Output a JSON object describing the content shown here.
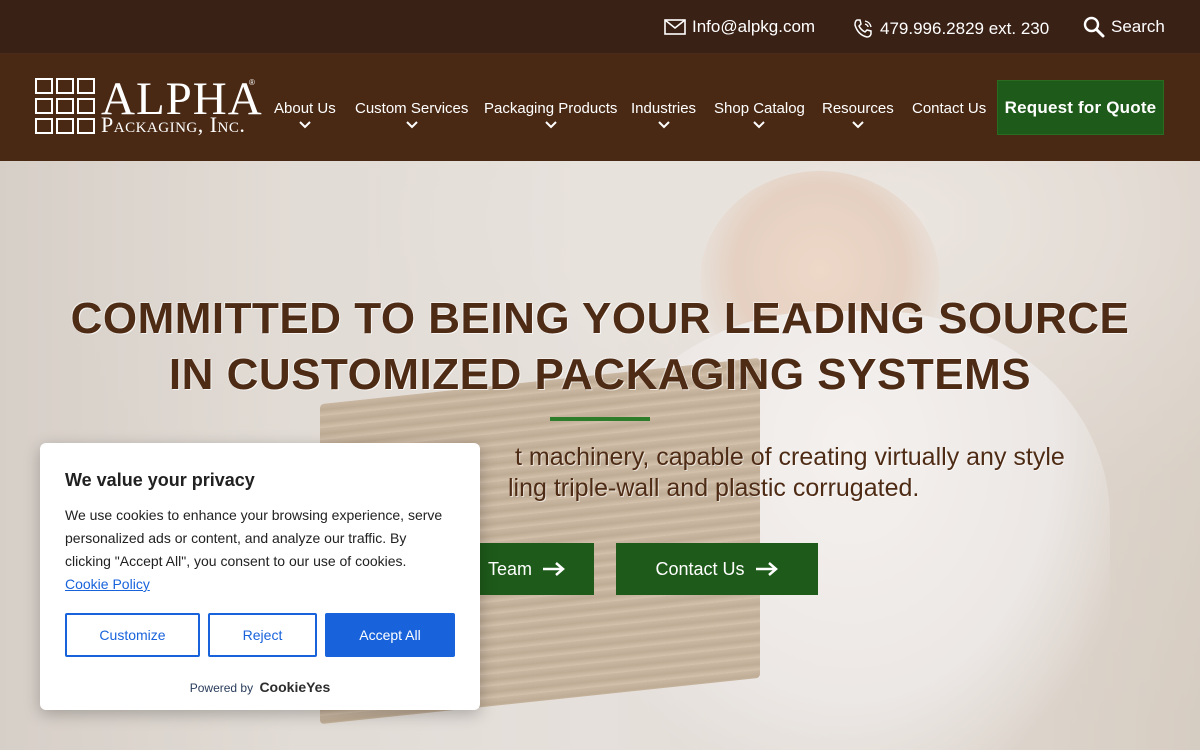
{
  "topbar": {
    "email": "Info@alpkg.com",
    "phone": "479.996.2829 ext. 230",
    "search": "Search"
  },
  "logo": {
    "word": "ALPHA",
    "sub": "Packaging, Inc.",
    "tm": "®"
  },
  "nav": {
    "items": [
      {
        "label": "About Us"
      },
      {
        "label": "Custom Services"
      },
      {
        "label": "Packaging Products"
      },
      {
        "label": "Industries"
      },
      {
        "label": "Shop Catalog"
      },
      {
        "label": "Resources"
      },
      {
        "label": "Contact Us"
      }
    ],
    "cta": "Request for Quote"
  },
  "hero": {
    "title_line1": "COMMITTED TO BEING YOUR LEADING SOURCE",
    "title_line2": "IN CUSTOMIZED PACKAGING SYSTEMS",
    "sub_line1": "t machinery, capable of creating virtually any style",
    "sub_line2": "ling triple-wall and plastic corrugated.",
    "btn_team": "Team",
    "btn_contact": "Contact Us"
  },
  "cookie": {
    "title": "We value your privacy",
    "text": "We use cookies to enhance your browsing experience, serve personalized ads or content, and analyze our traffic. By clicking \"Accept All\", you consent to our use of cookies.",
    "policy_link": "Cookie Policy",
    "customize": "Customize",
    "reject": "Reject",
    "accept": "Accept All",
    "powered_by": "Powered by",
    "brand": "CookieYes"
  },
  "colors": {
    "topbar_bg": "#3a2116",
    "nav_bg": "#4a2914",
    "cta_green": "#1e5a1a",
    "hero_text": "#4e2b14",
    "cookie_blue": "#1863dc"
  },
  "icons": {
    "email": "envelope-icon",
    "phone": "phone-icon",
    "search": "magnifier-icon",
    "chevron": "chevron-down-icon",
    "arrow": "arrow-right-icon"
  }
}
